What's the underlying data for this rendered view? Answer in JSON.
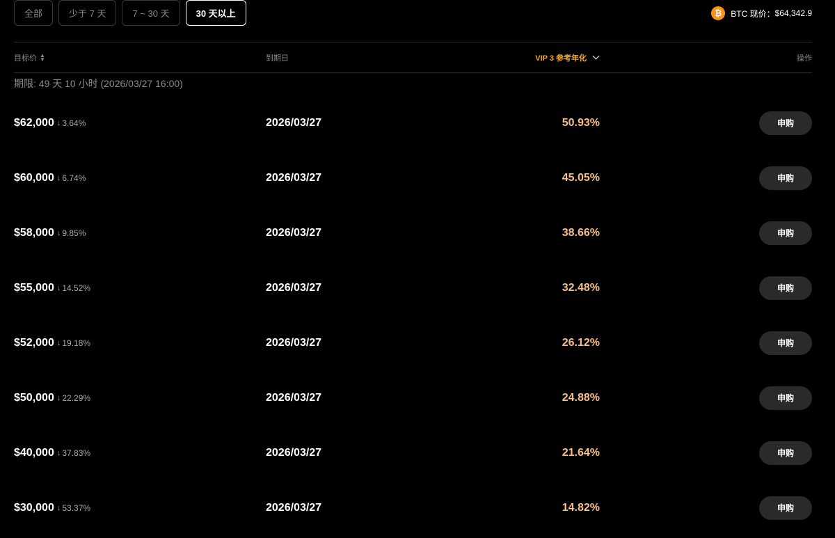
{
  "filters": {
    "tabs": [
      {
        "label": "全部",
        "active": false
      },
      {
        "label": "少于 7 天",
        "active": false
      },
      {
        "label": "7 ~ 30 天",
        "active": false
      },
      {
        "label": "30 天以上",
        "active": true
      }
    ]
  },
  "btc": {
    "icon": "bitcoin-icon",
    "label": "BTC 现价：",
    "price": "$64,342.9"
  },
  "table": {
    "headers": {
      "target_price": "目标价",
      "expiry": "到期日",
      "apy": "VIP 3 参考年化",
      "action": "操作"
    },
    "period": "期限:   49 天 10 小时 (2026/03/27 16:00)",
    "rows": [
      {
        "price": "$62,000",
        "change": "3.64%",
        "date": "2026/03/27",
        "apy": "50.93%",
        "button": "申购"
      },
      {
        "price": "$60,000",
        "change": "6.74%",
        "date": "2026/03/27",
        "apy": "45.05%",
        "button": "申购"
      },
      {
        "price": "$58,000",
        "change": "9.85%",
        "date": "2026/03/27",
        "apy": "38.66%",
        "button": "申购"
      },
      {
        "price": "$55,000",
        "change": "14.52%",
        "date": "2026/03/27",
        "apy": "32.48%",
        "button": "申购"
      },
      {
        "price": "$52,000",
        "change": "19.18%",
        "date": "2026/03/27",
        "apy": "26.12%",
        "button": "申购"
      },
      {
        "price": "$50,000",
        "change": "22.29%",
        "date": "2026/03/27",
        "apy": "24.88%",
        "button": "申购"
      },
      {
        "price": "$40,000",
        "change": "37.83%",
        "date": "2026/03/27",
        "apy": "21.64%",
        "button": "申购"
      },
      {
        "price": "$30,000",
        "change": "53.37%",
        "date": "2026/03/27",
        "apy": "14.82%",
        "button": "申购"
      }
    ]
  },
  "colors": {
    "background": "#000000",
    "accent_apy": "#f7c08a",
    "header_apy": "#f5a623",
    "btc_orange": "#f7931a",
    "button_bg": "#2a2a2a"
  }
}
